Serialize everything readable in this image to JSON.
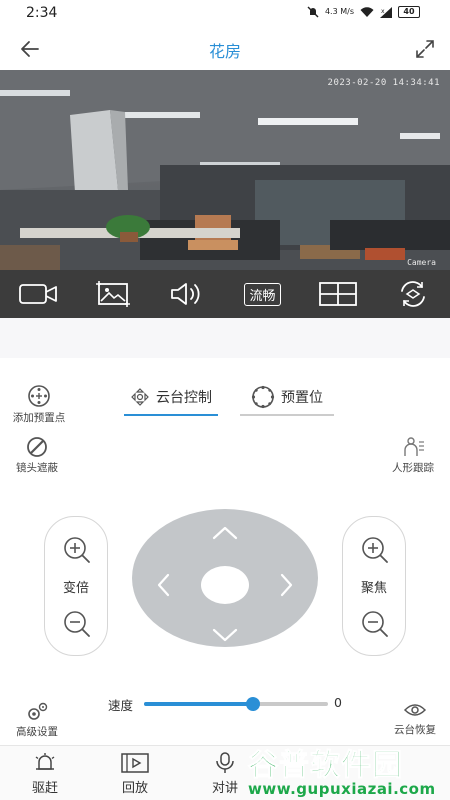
{
  "status_bar": {
    "time": "2:34",
    "network_speed": "4.3 M/s",
    "battery": "40"
  },
  "header": {
    "title": "花房"
  },
  "video": {
    "timestamp": "2023-02-20 14:34:41",
    "camera_label": "Camera"
  },
  "video_toolbar": {
    "record_icon": "video-camera-icon",
    "snapshot_icon": "image-icon",
    "audio_icon": "speaker-icon",
    "stream_quality": "流畅",
    "layout_icon": "split-grid-icon",
    "switch_icon": "camera-rotate-icon"
  },
  "left_tools": {
    "add_preset": "添加预置点",
    "lens_mask": "镜头遮蔽",
    "advanced": "高级设置"
  },
  "right_tools": {
    "human_tracking": "人形跟踪",
    "ptz_reset": "云台恢复"
  },
  "tabs": [
    {
      "label": "云台控制",
      "active": true
    },
    {
      "label": "预置位",
      "active": false
    }
  ],
  "zoom": {
    "label": "变倍"
  },
  "focus": {
    "label": "聚焦"
  },
  "speed": {
    "label": "速度",
    "value": "0",
    "level": 0.59
  },
  "bottom_nav": [
    {
      "label": "驱赶",
      "icon": "alarm-bell-icon"
    },
    {
      "label": "回放",
      "icon": "playback-film-icon"
    },
    {
      "label": "对讲",
      "icon": "microphone-icon"
    }
  ],
  "watermark": {
    "brand": "谷普软件园",
    "url": "www.gupuxiazai.com"
  },
  "colors": {
    "accent": "#2a8fd6",
    "toolbar_bg": "#3c3c3c",
    "dpad": "#c3c6c9",
    "watermark": "#1da84a"
  }
}
